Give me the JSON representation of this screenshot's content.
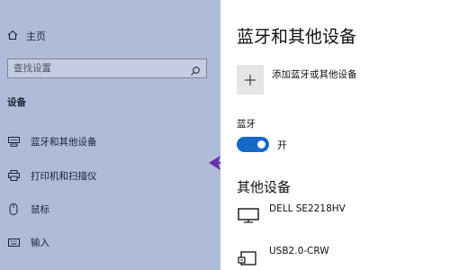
{
  "sidebar": {
    "home_label": "主页",
    "search_placeholder": "查找设置",
    "section_title": "设备",
    "items": [
      {
        "label": "蓝牙和其他设备",
        "icon": "bluetooth-devices-icon"
      },
      {
        "label": "打印机和扫描仪",
        "icon": "printer-icon"
      },
      {
        "label": "鼠标",
        "icon": "mouse-icon"
      },
      {
        "label": "输入",
        "icon": "keyboard-icon"
      }
    ],
    "background_color": "#aebbd9"
  },
  "main": {
    "title": "蓝牙和其他设备",
    "add_device_label": "添加蓝牙或其他设备",
    "bluetooth": {
      "label": "蓝牙",
      "state_label": "开",
      "on": true,
      "accent_color": "#1669c9"
    },
    "other_devices_title": "其他设备",
    "devices": [
      {
        "name": "DELL SE2218HV",
        "icon": "monitor-icon"
      },
      {
        "name": "USB2.0-CRW",
        "icon": "card-reader-icon"
      }
    ]
  },
  "annotation": {
    "arrow_color": "#6a2bb0"
  }
}
